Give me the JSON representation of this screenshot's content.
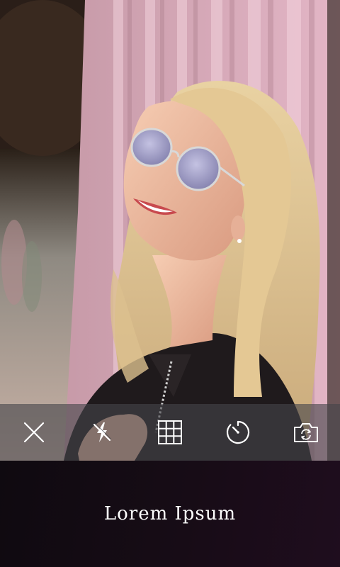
{
  "preview": {
    "subject": "camera-preview-photo"
  },
  "toolbar": {
    "items": [
      {
        "name": "close-button",
        "icon": "close-icon"
      },
      {
        "name": "flash-off-button",
        "icon": "flash-off-icon"
      },
      {
        "name": "grid-button",
        "icon": "grid-icon"
      },
      {
        "name": "timer-button",
        "icon": "timer-icon"
      },
      {
        "name": "switch-camera-button",
        "icon": "switch-camera-icon"
      }
    ],
    "icon_color": "#ffffff"
  },
  "caption": {
    "text": "Lorem Ipsum"
  },
  "colors": {
    "panel_background": "#150b14",
    "toolbar_overlay": "#46464a"
  }
}
